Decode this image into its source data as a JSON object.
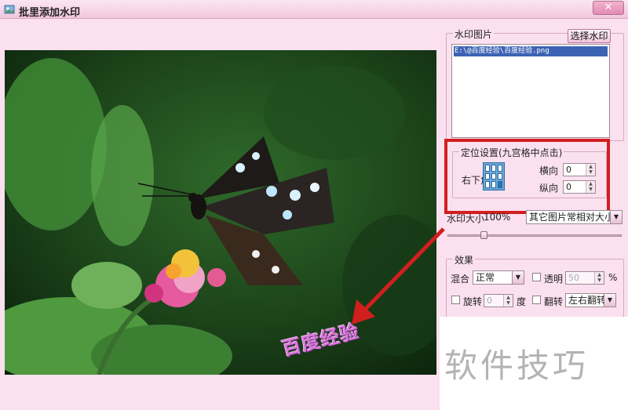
{
  "window": {
    "title": "批里添加水印",
    "close_label": "✕"
  },
  "preview": {
    "watermark_text": "百度经验"
  },
  "watermark_image": {
    "group_title": "水印图片",
    "select_button": "选择水印",
    "selected_file": "E:\\@百度经验\\百度经验.png"
  },
  "position": {
    "group_title": "定位设置(九宫格中点击)",
    "anchor_label": "右下角",
    "horizontal_label": "横向",
    "horizontal_value": "0",
    "vertical_label": "纵向",
    "vertical_value": "0"
  },
  "size": {
    "label": "水印大小",
    "percent": "100%",
    "mode_value": "其它图片常相对大小"
  },
  "effects": {
    "group_title": "效果",
    "blend_label": "混合",
    "blend_value": "正常",
    "transparent_label": "透明",
    "transparent_value": "50",
    "percent_sign": "%",
    "rotate_label": "旋转",
    "rotate_value": "0",
    "degree_label": "度",
    "flip_label": "翻转",
    "flip_value": "左右翻转"
  },
  "site_watermark": "软件技巧",
  "colors": {
    "window_bg": "#fbe0ef",
    "title_bg": "#f2c6de",
    "highlight_red": "#d11f1f",
    "selection_blue": "#3c63b3"
  }
}
